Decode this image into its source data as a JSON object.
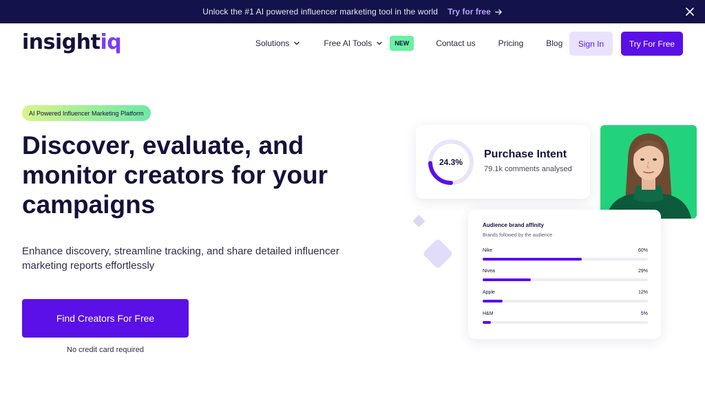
{
  "announcement": {
    "message": "Unlock the #1 AI powered influencer marketing tool in the world",
    "cta": "Try for free"
  },
  "header": {
    "logo": {
      "main": "insight",
      "accent": "iq"
    },
    "nav": {
      "solutions": "Solutions",
      "ai_tools": "Free AI Tools",
      "new_badge": "NEW",
      "contact": "Contact us",
      "pricing": "Pricing",
      "blog": "Blog"
    },
    "sign_in": "Sign In",
    "try_free": "Try For Free"
  },
  "hero": {
    "pill": "AI Powered Influencer Marketing Platform",
    "title_line1": "Discover, evaluate, and",
    "title_line2": "monitor creators for your",
    "title_line3": "campaigns",
    "subtitle_line1": "Enhance discovery, streamline tracking, and share detailed influencer",
    "subtitle_line2": "marketing reports effortlessly",
    "cta": "Find Creators For Free",
    "cta_note": "No credit card required"
  },
  "intent_card": {
    "value_label": "24.3%",
    "value": 24.3,
    "title": "Purchase Intent",
    "subtitle": "79.1k comments analysed"
  },
  "affinity_card": {
    "title": "Audience brand affinity",
    "subtitle": "Brands followed by the audience",
    "brands": [
      {
        "name": "Nike",
        "label": "60%",
        "value": 60
      },
      {
        "name": "Nivea",
        "label": "29%",
        "value": 29
      },
      {
        "name": "Apple",
        "label": "12%",
        "value": 12
      },
      {
        "name": "H&M",
        "label": "5%",
        "value": 5
      }
    ]
  },
  "colors": {
    "primary": "#5a10e6",
    "navy": "#14124a",
    "accent_purple": "#7a3cff",
    "green": "#22d37c",
    "new_badge": "#6cf0a3"
  },
  "icons": {
    "announce_arrow": "arrow-right-icon",
    "close": "close-icon",
    "dropdown": "chevron-down-icon"
  }
}
